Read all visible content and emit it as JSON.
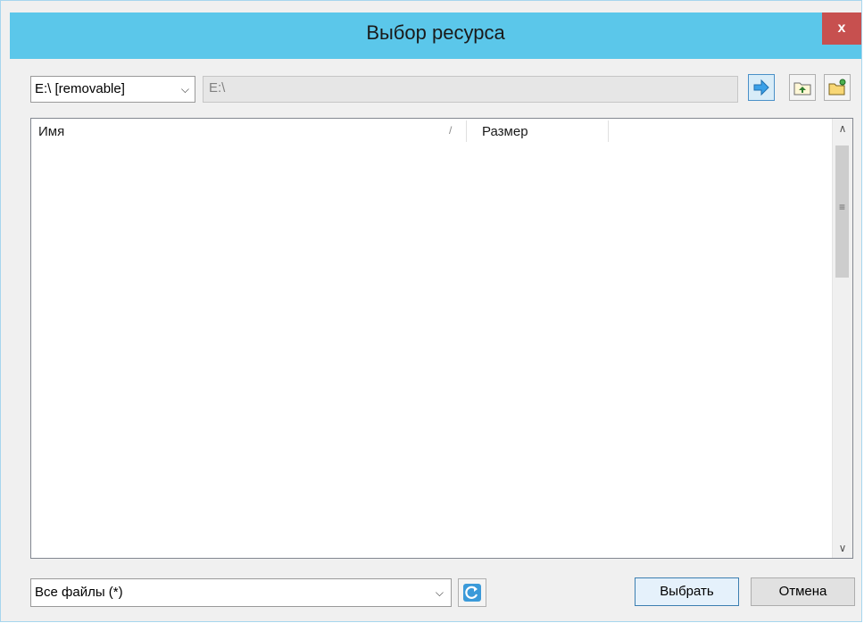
{
  "window": {
    "title": "Выбор ресурса",
    "close_label": "x"
  },
  "toolbar": {
    "drive_selected": "E:\\ [removable]",
    "path_value": "E:\\",
    "go_icon": "arrow-right-icon",
    "up_icon": "folder-up-icon",
    "new_folder_icon": "new-folder-icon"
  },
  "file_list": {
    "columns": [
      "Имя",
      "Размер"
    ],
    "sort_indicator": "/"
  },
  "bottom": {
    "filter_selected": "Все файлы (*)",
    "refresh_icon": "refresh-icon",
    "select_label": "Выбрать",
    "cancel_label": "Отмена"
  },
  "colors": {
    "titlebar": "#5bc7ea",
    "close": "#c7504f",
    "accent": "#3c7fb1"
  }
}
